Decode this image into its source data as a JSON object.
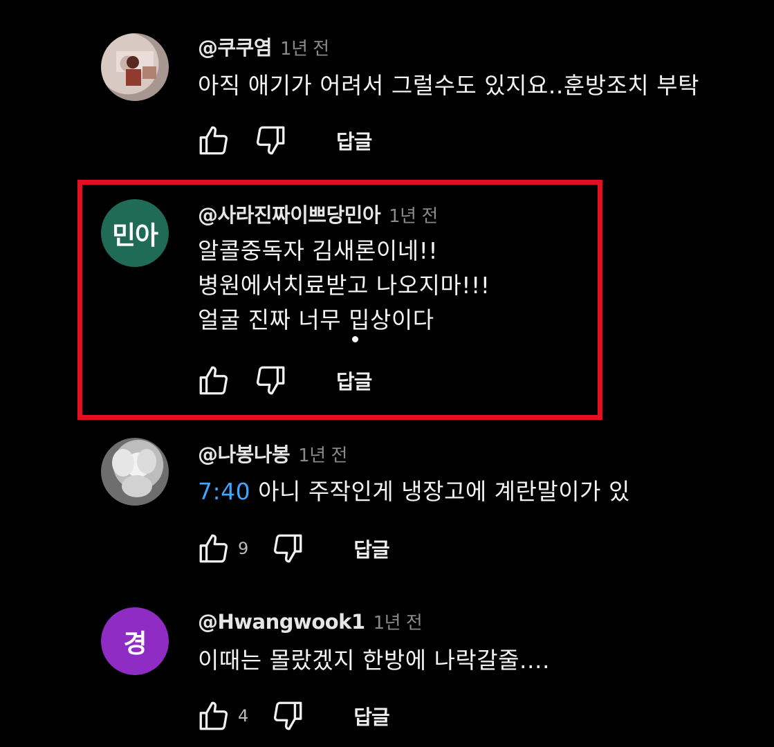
{
  "comments": [
    {
      "author": "@쿠쿠염",
      "time": "1년 전",
      "lines": [
        "아직 애기가 어려서 그럴수도 있지요..훈방조치 부탁"
      ],
      "reply_label": "답글",
      "avatar": {
        "type": "photo",
        "icon": "profile-photo",
        "colors": [
          "#d8c8c2",
          "#8a4a3c",
          "#f0e8e4"
        ]
      }
    },
    {
      "author": "@사라진짜이쁘당민아",
      "time": "1년 전",
      "lines": [
        "알콜중독자 김새론이네!!",
        "병원에서치료받고 나오지마!!!",
        "얼굴 진짜 너무 밉상이다"
      ],
      "reply_label": "답글",
      "avatar": {
        "type": "text",
        "text": "민아",
        "color": "#1f6b55"
      },
      "highlighted": true,
      "highlight_color": "#e3101f"
    },
    {
      "author": "@나봉나봉",
      "time": "1년 전",
      "timestamp_link": "7:40",
      "lines": [
        "아니 주작인게 냉장고에 계란말이가 있"
      ],
      "likes": "9",
      "reply_label": "답글",
      "avatar": {
        "type": "photo",
        "icon": "white-object-photo",
        "colors": [
          "#cfcfcf",
          "#7e7e7e",
          "#f2f2f2"
        ]
      }
    },
    {
      "author": "@Hwangwook1",
      "time": "1년 전",
      "lines": [
        "이때는 몰랐겠지 한방에 나락갈줄...."
      ],
      "likes": "4",
      "reply_label": "답글",
      "avatar": {
        "type": "text",
        "text": "경",
        "color": "#8e2cc3"
      }
    }
  ],
  "icons": {
    "like": "thumbs-up-icon",
    "dislike": "thumbs-down-icon"
  },
  "colors": {
    "background": "#000000",
    "link": "#3ea6ff"
  }
}
